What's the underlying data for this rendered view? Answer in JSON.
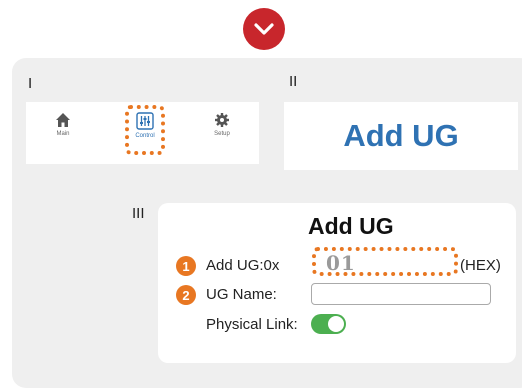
{
  "colors": {
    "accent": "#c8262c",
    "highlight": "#e87722",
    "title_blue": "#2f72b3",
    "toggle_on": "#4caf50"
  },
  "sections": {
    "one": "I",
    "two": "II",
    "three": "III"
  },
  "nav": {
    "items": [
      {
        "label": "Main",
        "icon": "home-icon"
      },
      {
        "label": "Control",
        "icon": "sliders-icon"
      },
      {
        "label": "Setup",
        "icon": "gear-icon"
      }
    ]
  },
  "panel_title": "Add UG",
  "form": {
    "title": "Add UG",
    "step1": "1",
    "step2": "2",
    "add_ug_label": "Add UG:0x",
    "add_ug_value": "01",
    "hex_suffix": "(HEX)",
    "ug_name_label": "UG Name:",
    "ug_name_value": "",
    "physical_link_label": "Physical Link:",
    "physical_link_on": true
  }
}
